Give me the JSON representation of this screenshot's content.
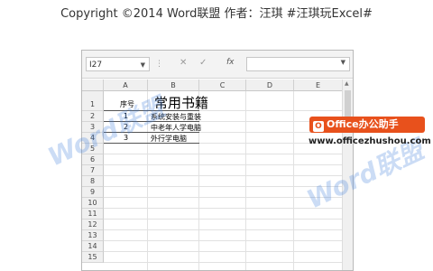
{
  "header": {
    "copyright": "Copyright ©2014 Word联盟    作者：汪琪   #汪琪玩Excel#"
  },
  "formula_bar": {
    "name_box": "I27",
    "fx_label": "fx",
    "formula": ""
  },
  "columns": [
    "A",
    "B",
    "C",
    "D",
    "E"
  ],
  "rows": [
    "1",
    "2",
    "3",
    "4",
    "5",
    "6",
    "7",
    "8",
    "9",
    "10",
    "11",
    "12",
    "13",
    "14",
    "15"
  ],
  "sheet": {
    "a1": "序号",
    "b1": "常用书籍",
    "a2": "1",
    "b2": "系统安装与重装",
    "a3": "2",
    "b3": "中老年人学电脑",
    "a4": "3",
    "b4": "外行学电脑"
  },
  "watermark": {
    "text_left": "Word联盟",
    "text_right": "Word联盟",
    "logo": "Office办公助手",
    "url": "www.officezhushou.com"
  },
  "colors": {
    "logo_bg": "#e8511c",
    "watermark": "#4682dc"
  }
}
